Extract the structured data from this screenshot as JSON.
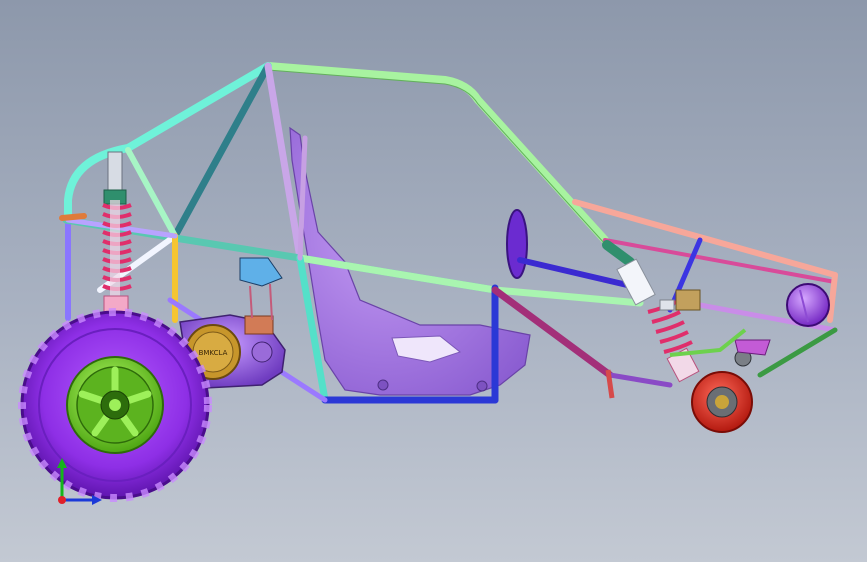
{
  "viewport": {
    "background_top": "#8d98ab",
    "background_bottom": "#c3c9d3"
  },
  "model": {
    "engine_label": "BMKCLA"
  },
  "triad": {
    "x_color": "#1b39d8",
    "y_color": "#15b51a",
    "origin_color": "#e0202a"
  }
}
